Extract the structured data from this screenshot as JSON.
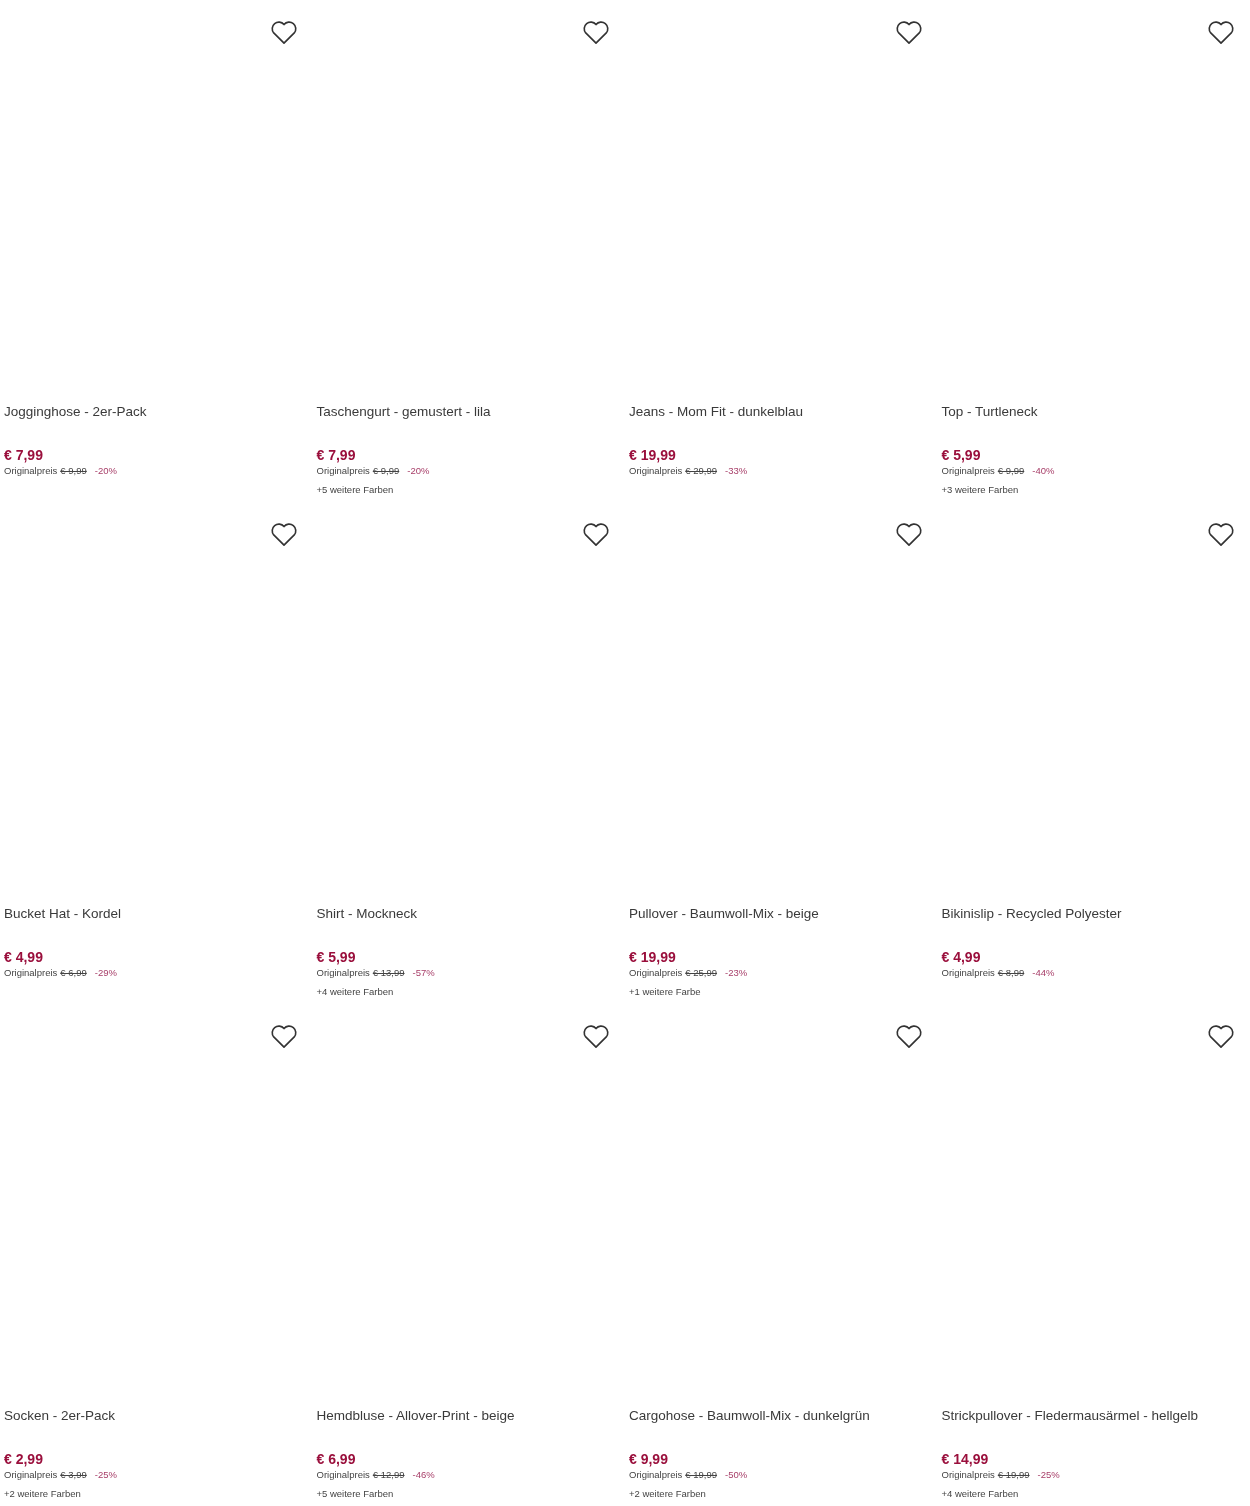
{
  "products": [
    {
      "name": "Jogginghose - 2er-Pack",
      "price": "€ 7,99",
      "original_label": "Originalpreis",
      "original_price": "€ 9,99",
      "discount": "-20%",
      "favorite": false
    },
    {
      "name": "Taschengurt - gemustert - lila",
      "price": "€ 7,99",
      "original_label": "Originalpreis",
      "original_price": "€ 9,99",
      "discount": "-20%",
      "more_colors": "+5 weitere Farben",
      "favorite": false
    },
    {
      "name": "Jeans - Mom Fit - dunkelblau",
      "price": "€ 19,99",
      "original_label": "Originalpreis",
      "original_price": "€ 29,99",
      "discount": "-33%",
      "favorite": false
    },
    {
      "name": "Top - Turtleneck",
      "price": "€ 5,99",
      "original_label": "Originalpreis",
      "original_price": "€ 9,99",
      "discount": "-40%",
      "more_colors": "+3 weitere Farben",
      "favorite": false
    },
    {
      "name": "Bucket Hat - Kordel",
      "price": "€ 4,99",
      "original_label": "Originalpreis",
      "original_price": "€ 6,99",
      "discount": "-29%",
      "favorite": false
    },
    {
      "name": "Shirt - Mockneck",
      "price": "€ 5,99",
      "original_label": "Originalpreis",
      "original_price": "€ 13,99",
      "discount": "-57%",
      "more_colors": "+4 weitere Farben",
      "favorite": false
    },
    {
      "name": "Pullover - Baumwoll-Mix - beige",
      "price": "€ 19,99",
      "original_label": "Originalpreis",
      "original_price": "€ 25,99",
      "discount": "-23%",
      "more_colors": "+1 weitere Farbe",
      "favorite": false
    },
    {
      "name": "Bikinislip - Recycled Polyester",
      "price": "€ 4,99",
      "original_label": "Originalpreis",
      "original_price": "€ 8,99",
      "discount": "-44%",
      "favorite": false
    },
    {
      "name": "Socken - 2er-Pack",
      "price": "€ 2,99",
      "original_label": "Originalpreis",
      "original_price": "€ 3,99",
      "discount": "-25%",
      "more_colors": "+2 weitere Farben",
      "favorite": false
    },
    {
      "name": "Hemdbluse - Allover-Print - beige",
      "price": "€ 6,99",
      "original_label": "Originalpreis",
      "original_price": "€ 12,99",
      "discount": "-46%",
      "more_colors": "+5 weitere Farben",
      "favorite": false
    },
    {
      "name": "Cargohose - Baumwoll-Mix - dunkelgrün",
      "price": "€ 9,99",
      "original_label": "Originalpreis",
      "original_price": "€ 19,99",
      "discount": "-50%",
      "more_colors": "+2 weitere Farben",
      "favorite": false
    },
    {
      "name": "Strickpullover - Fledermausärmel - hellgelb",
      "price": "€ 14,99",
      "original_label": "Originalpreis",
      "original_price": "€ 19,99",
      "discount": "-25%",
      "more_colors": "+4 weitere Farben",
      "favorite": false
    }
  ]
}
